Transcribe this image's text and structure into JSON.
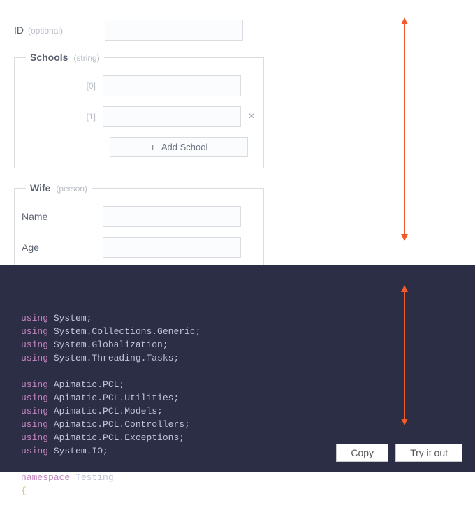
{
  "form": {
    "id": {
      "label": "ID",
      "hint": "(optional)",
      "value": ""
    },
    "schools": {
      "legend": "Schools",
      "hint": "(string)",
      "items": [
        {
          "index": "[0]",
          "value": ""
        },
        {
          "index": "[1]",
          "value": ""
        }
      ],
      "add_label": "Add School",
      "add_plus": "+"
    },
    "wife": {
      "legend": "Wife",
      "hint": "(person)",
      "name": {
        "label": "Name",
        "value": ""
      },
      "age": {
        "label": "Age",
        "value": ""
      }
    }
  },
  "code": {
    "lines": [
      {
        "kw": "using",
        "rest": " System;"
      },
      {
        "kw": "using",
        "rest": " System.Collections.Generic;"
      },
      {
        "kw": "using",
        "rest": " System.Globalization;"
      },
      {
        "kw": "using",
        "rest": " System.Threading.Tasks;"
      },
      {
        "kw": "",
        "rest": ""
      },
      {
        "kw": "using",
        "rest": " Apimatic.PCL;"
      },
      {
        "kw": "using",
        "rest": " Apimatic.PCL.Utilities;"
      },
      {
        "kw": "using",
        "rest": " Apimatic.PCL.Models;"
      },
      {
        "kw": "using",
        "rest": " Apimatic.PCL.Controllers;"
      },
      {
        "kw": "using",
        "rest": " Apimatic.PCL.Exceptions;"
      },
      {
        "kw": "using",
        "rest": " System.IO;"
      },
      {
        "kw": "",
        "rest": ""
      },
      {
        "kw": "namespace",
        "rest": " Testing"
      }
    ],
    "brace_line": "{"
  },
  "buttons": {
    "copy": "Copy",
    "try": "Try it out"
  }
}
